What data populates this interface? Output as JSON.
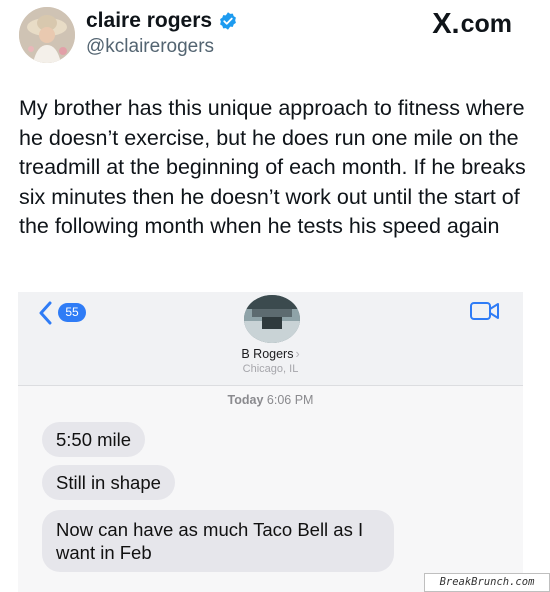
{
  "tweet": {
    "author_name": "claire rogers",
    "handle": "@kclairerogers",
    "site_label": "com",
    "site_x": "X.",
    "text": "My brother has this unique approach to fitness where he doesn’t exercise, but he does run one mile on the treadmill at the beginning of each month. If he breaks six minutes then he doesn’t work out until the start of the following month when he tests his speed again"
  },
  "messages_screenshot": {
    "unread_badge": "55",
    "contact_name": "B Rogers",
    "contact_chevron": "›",
    "contact_location": "Chicago, IL",
    "timestamp_day": "Today",
    "timestamp_time": "6:06 PM",
    "bubbles": [
      "5:50 mile",
      "Still in shape",
      "Now can have as much Taco Bell as I want in Feb"
    ]
  },
  "watermark": "BreakBrunch.com",
  "colors": {
    "verified_blue": "#1d9bf0",
    "imessage_link_blue": "#2f7cf6",
    "received_bubble": "#e6e6eb"
  },
  "icons": {
    "verified": "verified-badge-icon",
    "back": "chevron-left-icon",
    "video": "video-camera-icon"
  }
}
